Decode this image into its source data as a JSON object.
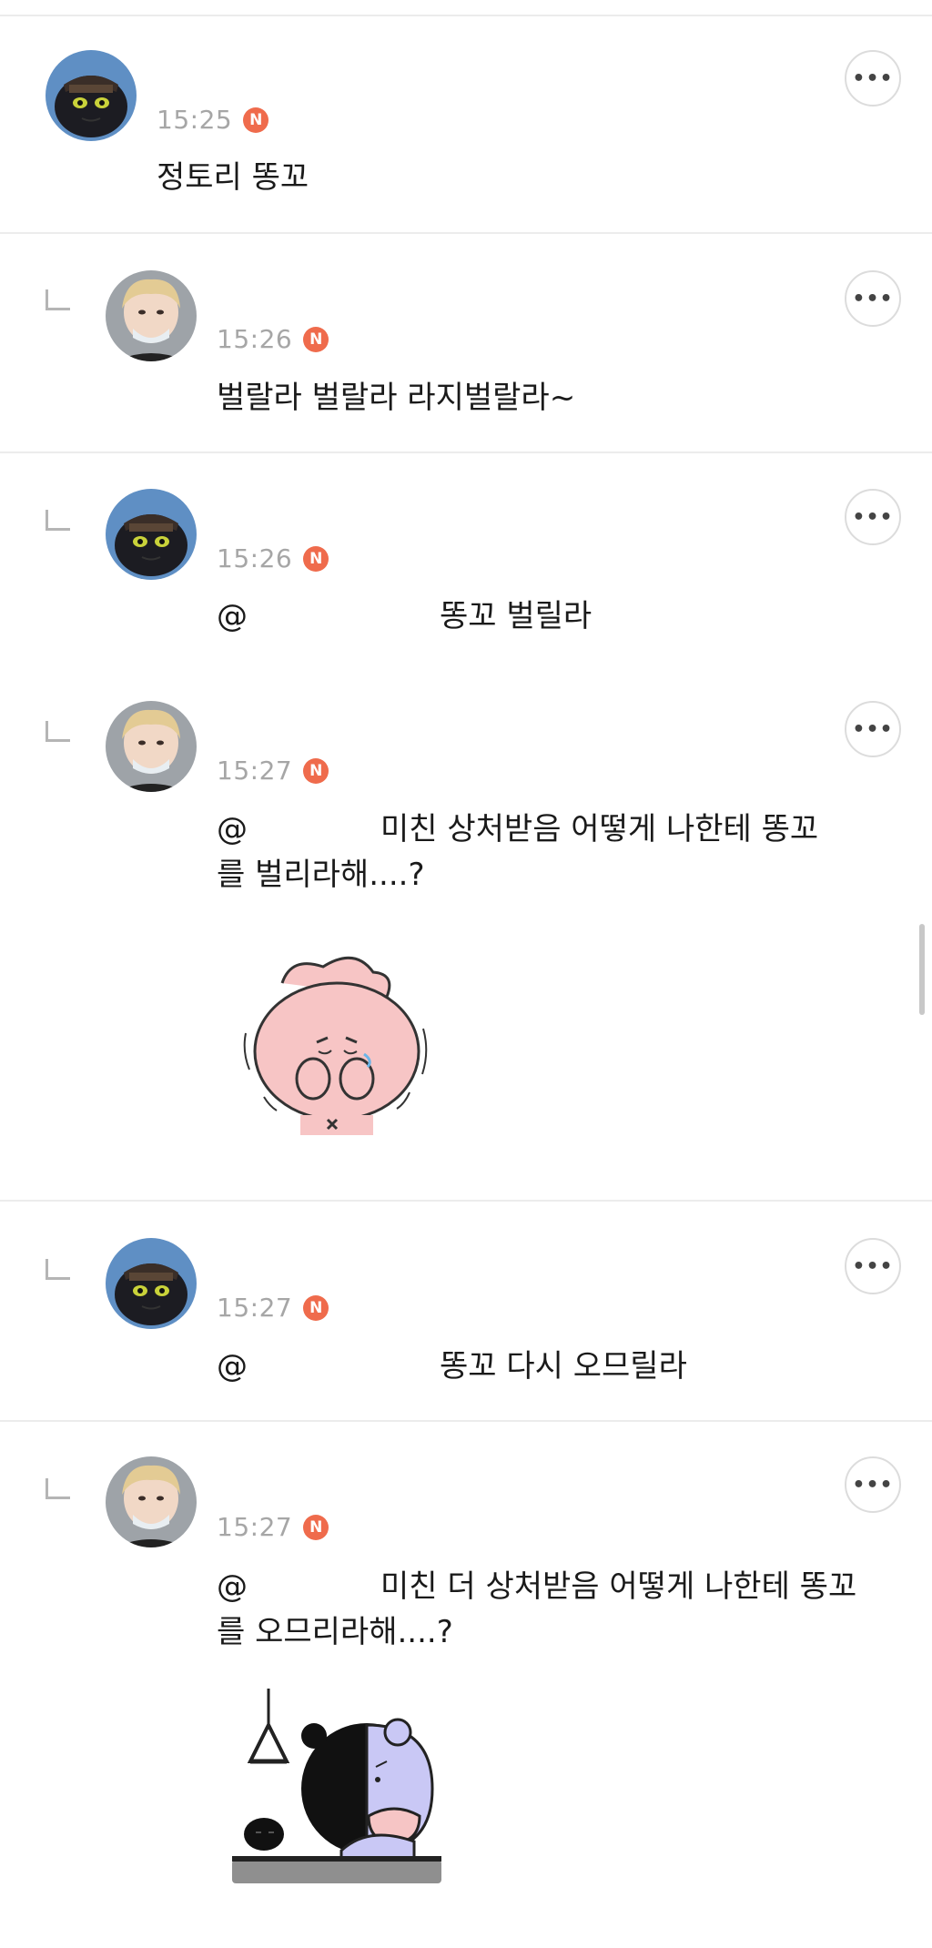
{
  "comments": [
    {
      "time": "15:25",
      "badge": "N",
      "lines": [
        "정토리 똥꼬"
      ],
      "avatar": "dragon"
    },
    {
      "time": "15:26",
      "badge": "N",
      "lines": [
        "벌랄라 벌랄라 라지벌랄라~"
      ],
      "avatar": "person"
    },
    {
      "time": "15:26",
      "badge": "N",
      "mention": "@",
      "lines": [
        "똥꼬 벌릴라"
      ],
      "avatar": "dragon"
    },
    {
      "time": "15:27",
      "badge": "N",
      "mention": "@",
      "lines": [
        "미친 상처받음 어떻게 나한테 똥꼬",
        "를 벌리라해....?"
      ],
      "avatar": "person",
      "sticker": "pink-bunny-crying"
    },
    {
      "time": "15:27",
      "badge": "N",
      "mention": "@",
      "lines": [
        "똥꼬 다시 오므릴라"
      ],
      "avatar": "dragon"
    },
    {
      "time": "15:27",
      "badge": "N",
      "mention": "@",
      "lines": [
        "미친 더 상처받음 어떻게 나한테 똥꼬",
        "를 오므리라해....?"
      ],
      "avatar": "person",
      "sticker": "sad-bear-lamp"
    }
  ],
  "more_label": "•••",
  "colors": {
    "badge": "#ef6b4c",
    "time": "#a6a6a6",
    "divider": "#ececec"
  }
}
